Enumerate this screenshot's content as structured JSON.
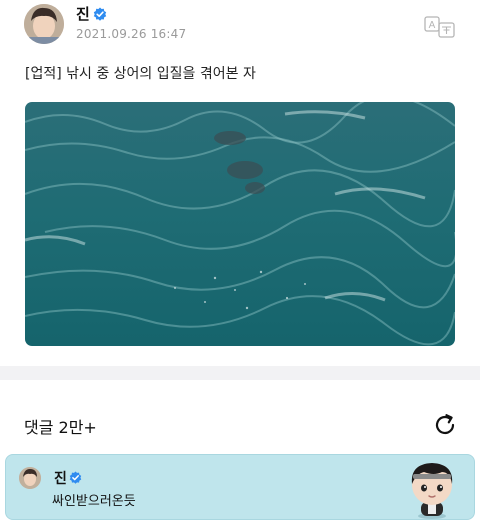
{
  "post": {
    "author": "진",
    "timestamp": "2021.09.26 16:47",
    "text": "[업적] 낚시 중 상어의 입질을 겪어본 자"
  },
  "comments": {
    "count_label": "댓글 2만+"
  },
  "featured_comment": {
    "author": "진",
    "text": "싸인받으러온듯"
  },
  "icons": {
    "verified": "verified-badge-icon",
    "translate": "translate-icon",
    "refresh": "refresh-icon"
  },
  "colors": {
    "verified": "#2f8cf0",
    "comment_card": "#bfe5ec",
    "timestamp": "#9a9a9a",
    "sea": "#1e6f78"
  }
}
